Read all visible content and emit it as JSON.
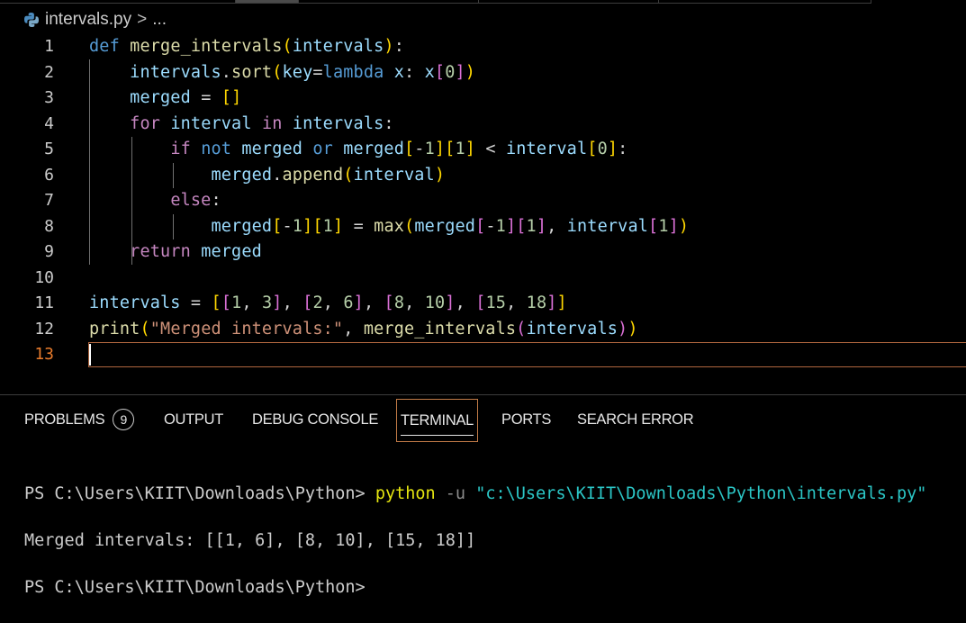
{
  "breadcrumb": {
    "file": "intervals.py",
    "sep": ">",
    "rest": "..."
  },
  "editor": {
    "line_numbers": [
      "1",
      "2",
      "3",
      "4",
      "5",
      "6",
      "7",
      "8",
      "9",
      "10",
      "11",
      "12",
      "13"
    ],
    "current_line": "13"
  },
  "panel": {
    "tabs": {
      "problems": "PROBLEMS",
      "problems_count": "9",
      "output": "OUTPUT",
      "debug_console": "DEBUG CONSOLE",
      "terminal": "TERMINAL",
      "ports": "PORTS",
      "search_error": "SEARCH ERROR"
    },
    "active_tab": "TERMINAL"
  },
  "terminal": {
    "prompt1": "PS C:\\Users\\KIIT\\Downloads\\Python> ",
    "cmd": "python",
    "flag": " -u ",
    "arg": "\"c:\\Users\\KIIT\\Downloads\\Python\\intervals.py\"",
    "output": "Merged intervals: [[1, 6], [8, 10], [15, 18]]",
    "prompt2": "PS C:\\Users\\KIIT\\Downloads\\Python>"
  },
  "colors": {
    "keyword_blue": "#569cd6",
    "keyword_purple": "#c586c0",
    "function": "#dcdcaa",
    "variable": "#9cdcfe",
    "number": "#b5cea8",
    "string": "#ce9178",
    "current_line_number": "#e87b2c",
    "active_tab_border": "#c27b47"
  },
  "icons": {
    "file_icon": "python-icon",
    "badge": "problems-count-badge"
  }
}
